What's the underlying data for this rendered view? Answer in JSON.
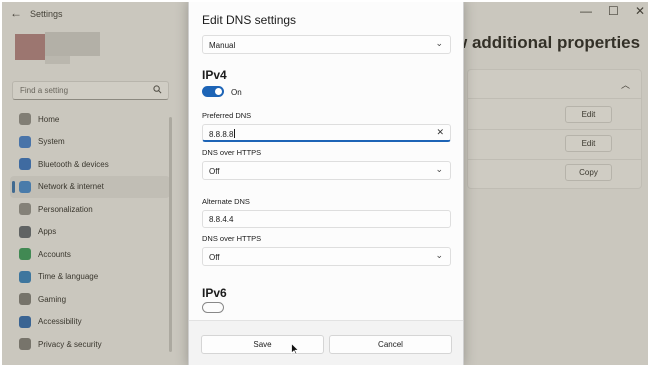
{
  "window": {
    "title": "Settings",
    "back_icon": "back-arrow-icon",
    "controls": {
      "minimize": "—",
      "maximize": "☐",
      "close": "✕"
    }
  },
  "search": {
    "placeholder": "Find a setting",
    "icon": "search-icon"
  },
  "nav": {
    "items": [
      {
        "label": "Home",
        "icon": "home-icon",
        "color": "#8a8a8a",
        "active": false
      },
      {
        "label": "System",
        "icon": "system-icon",
        "color": "#3a7bd5",
        "active": false
      },
      {
        "label": "Bluetooth & devices",
        "icon": "bluetooth-icon",
        "color": "#2b6fc9",
        "active": false
      },
      {
        "label": "Network & internet",
        "icon": "wifi-icon",
        "color": "#3a86d6",
        "active": true
      },
      {
        "label": "Personalization",
        "icon": "brush-icon",
        "color": "#8f8f8f",
        "active": false
      },
      {
        "label": "Apps",
        "icon": "apps-icon",
        "color": "#5b6470",
        "active": false
      },
      {
        "label": "Accounts",
        "icon": "accounts-icon",
        "color": "#2f9a5a",
        "active": false
      },
      {
        "label": "Time & language",
        "icon": "globe-clock-icon",
        "color": "#2a7fc4",
        "active": false
      },
      {
        "label": "Gaming",
        "icon": "gaming-icon",
        "color": "#7a7a7a",
        "active": false
      },
      {
        "label": "Accessibility",
        "icon": "accessibility-icon",
        "color": "#2565b5",
        "active": false
      },
      {
        "label": "Privacy & security",
        "icon": "shield-icon",
        "color": "#7b7b7b",
        "active": false
      }
    ]
  },
  "main": {
    "heading": "w additional properties",
    "buttons": {
      "edit1": "Edit",
      "edit2": "Edit",
      "copy": "Copy"
    }
  },
  "dialog": {
    "title": "Edit DNS settings",
    "mode_select": {
      "value": "Manual"
    },
    "ipv4": {
      "heading": "IPv4",
      "toggle_label": "On",
      "toggle_on": true,
      "preferred_label": "Preferred DNS",
      "preferred_value": "8.8.8.8",
      "https1_label": "DNS over HTTPS",
      "https1_value": "Off",
      "alternate_label": "Alternate DNS",
      "alternate_value": "8.8.4.4",
      "https2_label": "DNS over HTTPS",
      "https2_value": "Off"
    },
    "ipv6": {
      "heading": "IPv6"
    },
    "save_label": "Save",
    "cancel_label": "Cancel"
  },
  "colors": {
    "accent": "#1d64b6",
    "dim_overlay": "rgba(110,100,70,0.30)"
  }
}
